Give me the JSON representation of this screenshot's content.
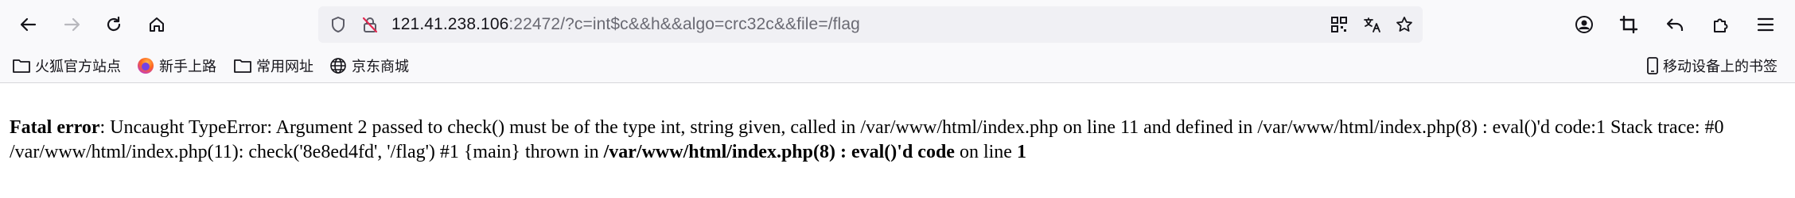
{
  "toolbar": {
    "back_icon": "back-arrow-icon",
    "forward_icon": "forward-arrow-icon",
    "reload_icon": "reload-icon",
    "home_icon": "home-icon"
  },
  "urlbar": {
    "host": "121.41.238.106",
    "rest": ":22472/?c=int$c&&h&&algo=crc32c&&file=/flag"
  },
  "bookmarks": {
    "items": [
      {
        "label": "火狐官方站点",
        "icon": "folder-icon"
      },
      {
        "label": "新手上路",
        "icon": "firefox-icon"
      },
      {
        "label": "常用网址",
        "icon": "folder-icon"
      },
      {
        "label": "京东商城",
        "icon": "globe-icon"
      }
    ],
    "mobile_label": "移动设备上的书签"
  },
  "error": {
    "label": "Fatal error",
    "message": ": Uncaught TypeError: Argument 2 passed to check() must be of the type int, string given, called in /var/www/html/index.php on line 11 and defined in /var/www/html/index.php(8) : eval()'d code:1 Stack trace: #0 /var/www/html/index.php(11): check('8e8ed4fd', '/flag') #1 {main} thrown in ",
    "location": "/var/www/html/index.php(8) : eval()'d code",
    "on_line_text": " on line ",
    "line": "1"
  }
}
